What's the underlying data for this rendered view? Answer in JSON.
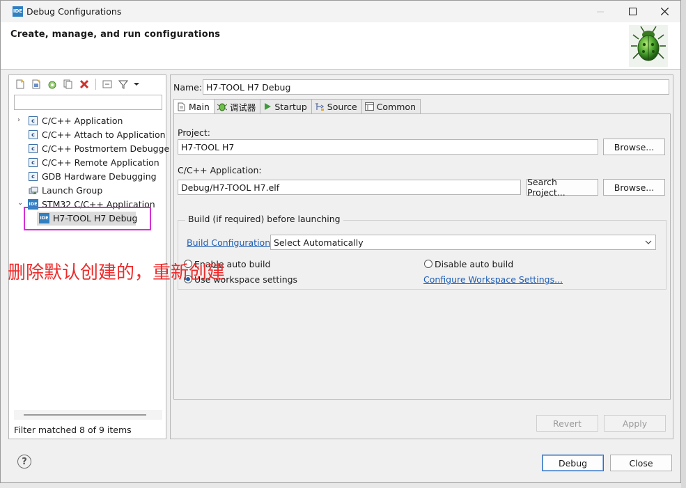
{
  "window": {
    "app_icon": "IDE",
    "title": "Debug Configurations"
  },
  "header": {
    "text": "Create, manage, and run configurations",
    "icon": "bug-icon"
  },
  "left": {
    "filter_placeholder": "",
    "tree": [
      {
        "label": "C/C++ Application",
        "icon": "c-icon",
        "expandable": true
      },
      {
        "label": "C/C++ Attach to Application",
        "icon": "c-icon"
      },
      {
        "label": "C/C++ Postmortem Debugge",
        "icon": "c-icon"
      },
      {
        "label": "C/C++ Remote Application",
        "icon": "c-icon"
      },
      {
        "label": "GDB Hardware Debugging",
        "icon": "c-icon"
      },
      {
        "label": "Launch Group",
        "icon": "launch-group-icon"
      },
      {
        "label": "STM32 C/C++ Application",
        "icon": "ide-icon",
        "expanded": true
      },
      {
        "label": "H7-TOOL H7 Debug",
        "icon": "ide-icon",
        "selected": true
      }
    ],
    "status": "Filter matched 8 of 9 items"
  },
  "annotation": "删除默认创建的，重新创建",
  "right": {
    "name_label": "Name:",
    "name_value": "H7-TOOL H7 Debug",
    "tabs": [
      {
        "label": "Main",
        "icon": "main-tab-icon",
        "active": true
      },
      {
        "label": "调试器",
        "icon": "debugger-icon"
      },
      {
        "label": "Startup",
        "icon": "startup-icon"
      },
      {
        "label": "Source",
        "icon": "source-icon"
      },
      {
        "label": "Common",
        "icon": "common-icon"
      }
    ],
    "project_label": "Project:",
    "project_value": "H7-TOOL H7",
    "browse_label": "Browse...",
    "app_label": "C/C++ Application:",
    "app_value": "Debug/H7-TOOL H7.elf",
    "search_project_label": "Search Project...",
    "build_group_title": "Build (if required) before launching",
    "build_config_link": "Build Configuration:",
    "build_config_value": "Select Automatically",
    "enable_auto_build": "Enable auto build",
    "disable_auto_build": "Disable auto build",
    "use_workspace": "Use workspace settings",
    "configure_workspace_link": "Configure Workspace Settings...",
    "revert_label": "Revert",
    "apply_label": "Apply"
  },
  "footer": {
    "help": "?",
    "debug_label": "Debug",
    "close_label": "Close"
  }
}
